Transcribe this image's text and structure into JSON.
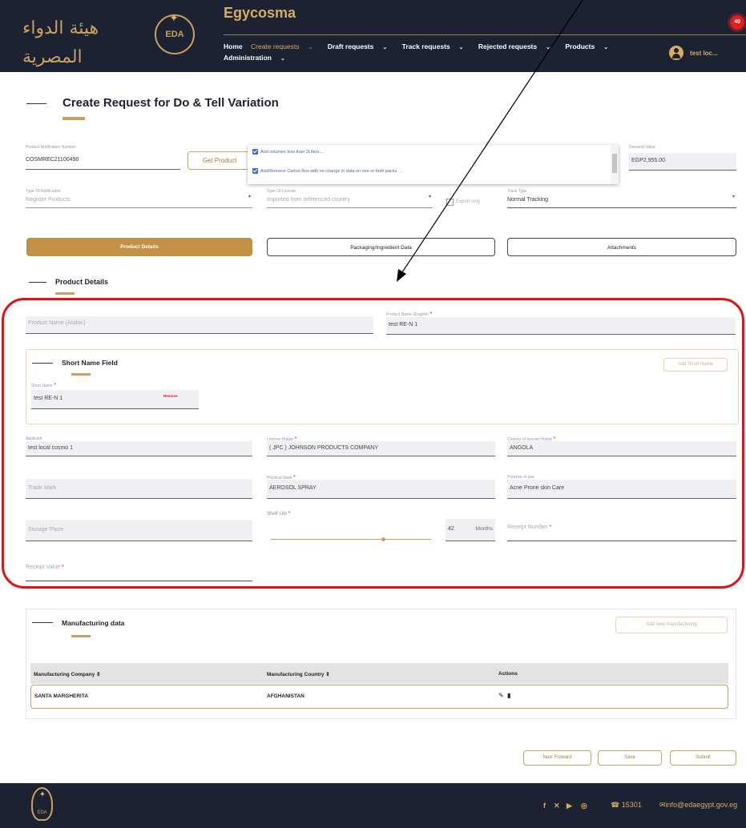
{
  "header": {
    "logo_text_arabic": "هيئة الدواء المصرية",
    "emblem_label": "EDA",
    "app_title": "Egycosma",
    "nav": {
      "home": "Home",
      "create_requests": "Create requests",
      "draft_requests": "Draft requests",
      "track_requests": "Track requests",
      "rejected_requests": "Rejected requests",
      "products": "Products",
      "administration": "Administration"
    },
    "notification_count": "40",
    "user_name": "test loc..."
  },
  "page": {
    "title": "Create Request for Do & Tell Variation"
  },
  "top_form": {
    "notification_number": {
      "label": "Product Notification Number",
      "value": "COSMREC21100490"
    },
    "get_product_label": "Get Product",
    "variation_options": [
      "Add volumes less than 2Liters ...",
      "Add/Remove Carton Box with no change in data on one or both packs ..."
    ],
    "demand_value": {
      "label": "Demand Value",
      "value": "EGP2,955.00"
    },
    "type_of_notification": {
      "label": "Type Of Notification",
      "value": "Register Products"
    },
    "type_of_license": {
      "label": "Type Of License",
      "value": "Imported from referenced country"
    },
    "export_only_label": "Export only",
    "track_type": {
      "label": "Track Type",
      "value": "Normal Tracking"
    }
  },
  "tabs": {
    "product_details": "Product Details",
    "packaging": "Packaging/Ingredient Data",
    "attachments": "Attachments"
  },
  "product_details": {
    "section_title": "Product Details",
    "product_name_arabic": {
      "label": "Product Name (Arabic)",
      "value": ""
    },
    "product_name_english": {
      "label": "Product Name (English)",
      "value": "test RE-N 1"
    },
    "short_name_section_title": "Short Name Field",
    "add_short_name_label": "Add Short Name",
    "short_name": {
      "label": "Short Name",
      "value": "test RE-N 1",
      "remove_label": "Remove"
    },
    "applicant": {
      "label": "Applicant",
      "value": "test local cosmo 1"
    },
    "license_holder": {
      "label": "License Holder",
      "value": "( JPC ) JOHNSON PRODUCTS COMPANY"
    },
    "country_of_license_holder": {
      "label": "Country of license Holder",
      "value": "ANGOLA"
    },
    "trade_mark": {
      "label": "Trade Mark",
      "value": ""
    },
    "physical_state": {
      "label": "Physical State",
      "value": "AEROSOL SPRAY"
    },
    "purpose_of_use": {
      "label": "Purpose of use",
      "value": "Acne Prone skin Care"
    },
    "storage_place": {
      "label": "Storage Place",
      "value": ""
    },
    "shelf_life": {
      "label": "Shelf Life",
      "value": "42",
      "unit": "Months",
      "slider_fraction": 0.7
    },
    "receipt_number": {
      "label": "Receipt Number",
      "value": ""
    },
    "receipt_value": {
      "label": "Receipt Value",
      "value": ""
    }
  },
  "manufacturing": {
    "section_title": "Manufacturing data",
    "add_label": "Add new manufacturing",
    "columns": [
      "Manufacturing Company ⇕",
      "Manufacturing Country ⇕",
      "Actions"
    ],
    "rows": [
      {
        "company": "SANTA MARGHERITA",
        "country": "AFGHANISTAN"
      }
    ]
  },
  "actions": {
    "next_forward": "Next Forward",
    "save": "Save",
    "submit": "Submit"
  },
  "footer": {
    "emblem_label": "EDA",
    "phone": "15301",
    "email": "info@edaegypt.gov.eg"
  },
  "colors": {
    "header_bg": "#1d2233",
    "gold": "#c9a160",
    "annotation_red": "#e01212"
  }
}
